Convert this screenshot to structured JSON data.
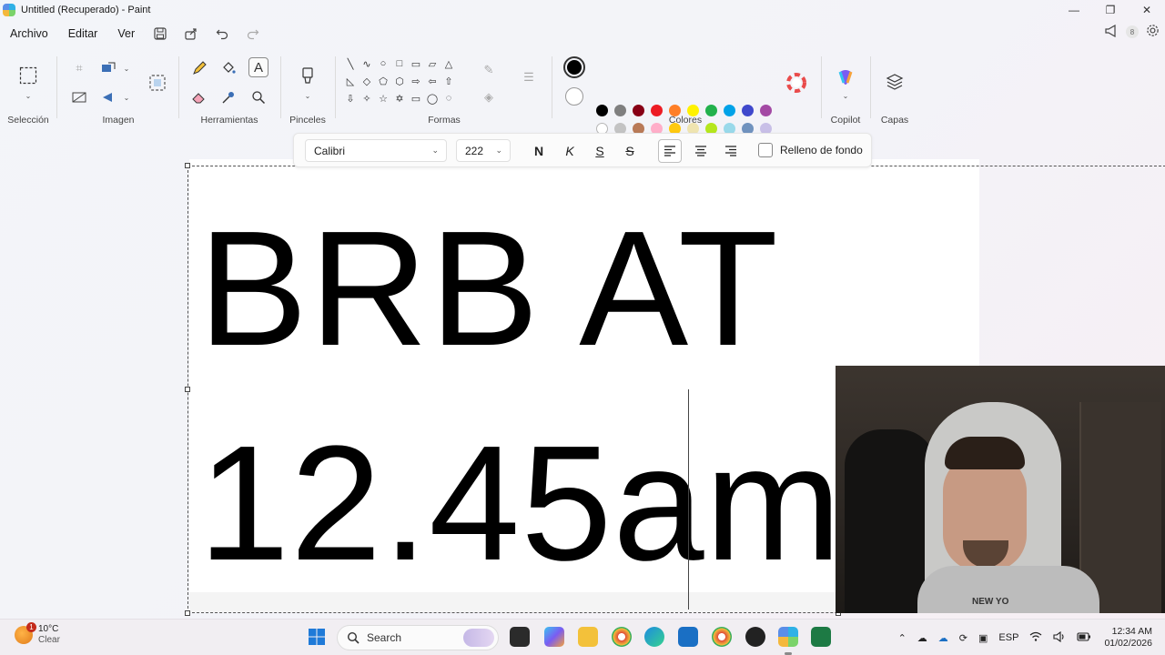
{
  "window": {
    "title": "Untitled (Recuperado) - Paint",
    "minimize": "—",
    "maximize": "❐",
    "close": "✕"
  },
  "menu": {
    "items": [
      "Archivo",
      "Editar",
      "Ver"
    ],
    "notification_count": "8"
  },
  "ribbon": {
    "groups": {
      "selection": "Selección",
      "image": "Imagen",
      "tools": "Herramientas",
      "brushes": "Pinceles",
      "shapes": "Formas",
      "colors": "Colores",
      "copilot": "Copilot",
      "layers": "Capas"
    },
    "shape_glyphs": [
      "╲",
      "∿",
      "○",
      "□",
      "▭",
      "▱",
      "△",
      "◺",
      "◇",
      "⬠",
      "⬡",
      "⇨",
      "⇦",
      "⇧",
      "⇩",
      "✧",
      "☆",
      "✡",
      "▭",
      "◯",
      "◌",
      "◠",
      "⌒"
    ],
    "primary_color": "#000000",
    "secondary_color": "#ffffff",
    "palette_row1": [
      "#000000",
      "#7f7f7f",
      "#880015",
      "#ed1c24",
      "#ff7f27",
      "#fff200",
      "#22b14c",
      "#00a2e8",
      "#3f48cc",
      "#a349a4"
    ],
    "palette_row2": [
      "#ffffff",
      "#c3c3c3",
      "#b97a57",
      "#ffaec9",
      "#ffc90e",
      "#efe4b0",
      "#b5e61d",
      "#99d9ea",
      "#7092be",
      "#c8bfe7"
    ]
  },
  "text_toolbar": {
    "font": "Calibri",
    "size": "222",
    "bold": "N",
    "italic": "K",
    "underline": "S",
    "strikethrough": "S",
    "background_fill_label": "Relleno de fondo"
  },
  "canvas": {
    "line1": "BRB AT",
    "line2": "12.45am"
  },
  "webcam": {
    "shirt_text": "NEW YO"
  },
  "taskbar": {
    "weather_temp": "10°C",
    "weather_desc": "Clear",
    "weather_badge": "1",
    "search_placeholder": "Search",
    "language": "ESP",
    "time": "12:34 AM",
    "date": "01/02/2026"
  }
}
